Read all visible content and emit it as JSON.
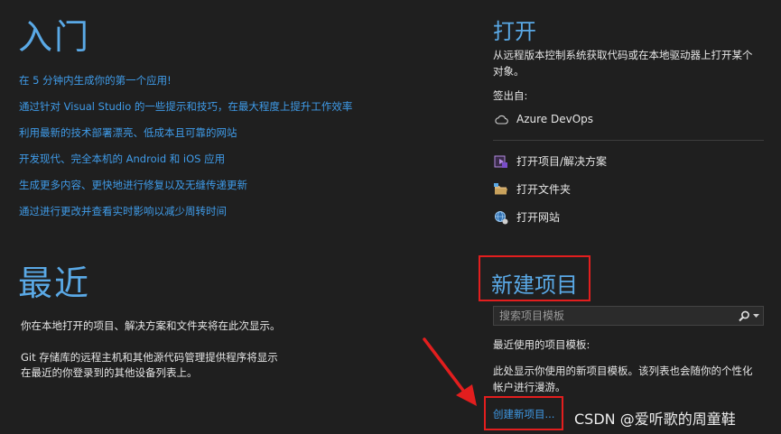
{
  "getting_started": {
    "title": "入门",
    "links": [
      "在 5 分钟内生成你的第一个应用!",
      "通过针对 Visual Studio 的一些提示和技巧，在最大程度上提升工作效率",
      "利用最新的技术部署漂亮、低成本且可靠的网站",
      "开发现代、完全本机的 Android 和 iOS 应用",
      "生成更多内容、更快地进行修复以及无缝传递更新",
      "通过进行更改并查看实时影响以减少周转时间"
    ]
  },
  "recent": {
    "title": "最近",
    "description1": "你在本地打开的项目、解决方案和文件夹将在此次显示。",
    "description2_line1": "Git 存储库的远程主机和其他源代码管理提供程序将显示",
    "description2_line2": "在最近的你登录到的其他设备列表上。"
  },
  "open": {
    "title": "打开",
    "description_line1": "从远程版本控制系统获取代码或在本地驱动器上打开某个",
    "description_line2": "对象。",
    "checkout_label": "签出自:",
    "azure_devops": "Azure DevOps",
    "open_project": "打开项目/解决方案",
    "open_folder": "打开文件夹",
    "open_website": "打开网站"
  },
  "new_project": {
    "title": "新建项目",
    "search_placeholder": "搜索项目模板",
    "recent_templates_label": "最近使用的项目模板:",
    "recent_templates_desc_line1": "此处显示你使用的新项目模板。该列表也会随你的个性化",
    "recent_templates_desc_line2": "帐户进行漫游。",
    "create_link": "创建新项目..."
  },
  "watermark": "CSDN @爱听歌的周童鞋",
  "colors": {
    "accent": "#5aa9e6",
    "link": "#3f9be8",
    "highlight": "#e21e1e",
    "background": "#1f1f1f"
  }
}
